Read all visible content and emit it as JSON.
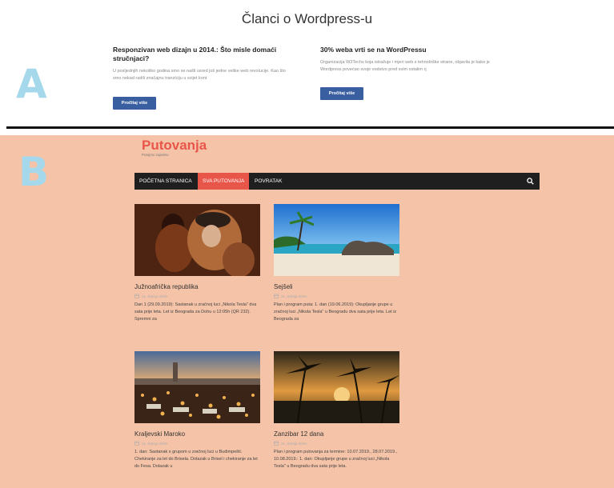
{
  "section_a": {
    "letter": "A",
    "title": "Članci o Wordpress-u",
    "articles": [
      {
        "title": "Responzivan web dizajn u 2014.: Što misle domaći stručnjaci?",
        "excerpt": "U posljednjih nekoliko godina smo se našli usred još jedne velike web revolucije. Kao što smo nekad radili značajnu tranziciju u svijet kont",
        "button": "Pročitaj više"
      },
      {
        "title": "30% weba vrti se na WordPressu",
        "excerpt": "Organizacija W3Techs koja istražuje i mjeri web s tehnološke strane, objavila je kako je Wordpress povećao svoje vodstvo pred svim ostalim rj",
        "button": "Pročitaj više"
      }
    ]
  },
  "section_b": {
    "letter": "B",
    "site_title": "Putovanja",
    "tagline": "Putujmo zajedno",
    "nav": [
      "POČETNA STRANICA",
      "SVA PUTOVANJA",
      "POVRATAK"
    ],
    "accent": "#e8564a",
    "background": "#f5c4a8",
    "posts": [
      {
        "title": "Južnoafrička republika",
        "date": "21. Srpnja 2019.",
        "excerpt": "Dan 1 (29.09.2019): Sastanak u zračnoj luci „Nikola Tesla\" dva sata prije leta. Let iz Beograda za Dohu u 12:05h (QR 232). Spremni za"
      },
      {
        "title": "Sejšeli",
        "date": "21. Srpnja 2019.",
        "excerpt": "Plan i program puta: 1. dan (19.06.2019): Okupljanje grupe u zračnoj luci „Nikola Tesla\" u Beogradu dva sata prije leta. Let iz Beograda za"
      },
      {
        "title": "Kraljevski Maroko",
        "date": "21. Srpnja 2019.",
        "excerpt": "1. dan: Sastanak s grupom u zračnoj luci u Budimpešti. Chekiranje za let do Brisela. Dolazak u Brisel i chekiranje za let do Fesa. Dolazak u"
      },
      {
        "title": "Zanzibar 12 dana",
        "date": "21. Srpnja 2019.",
        "excerpt": "Plan i program putovanja za termine: 10.07.2019., 28.07.2019., 10.08.2019.: 1. dan: Okupljanje grupe u zračnoj luci „Nikola Tesla\" u Beogradu dva sata prije leta."
      }
    ]
  }
}
